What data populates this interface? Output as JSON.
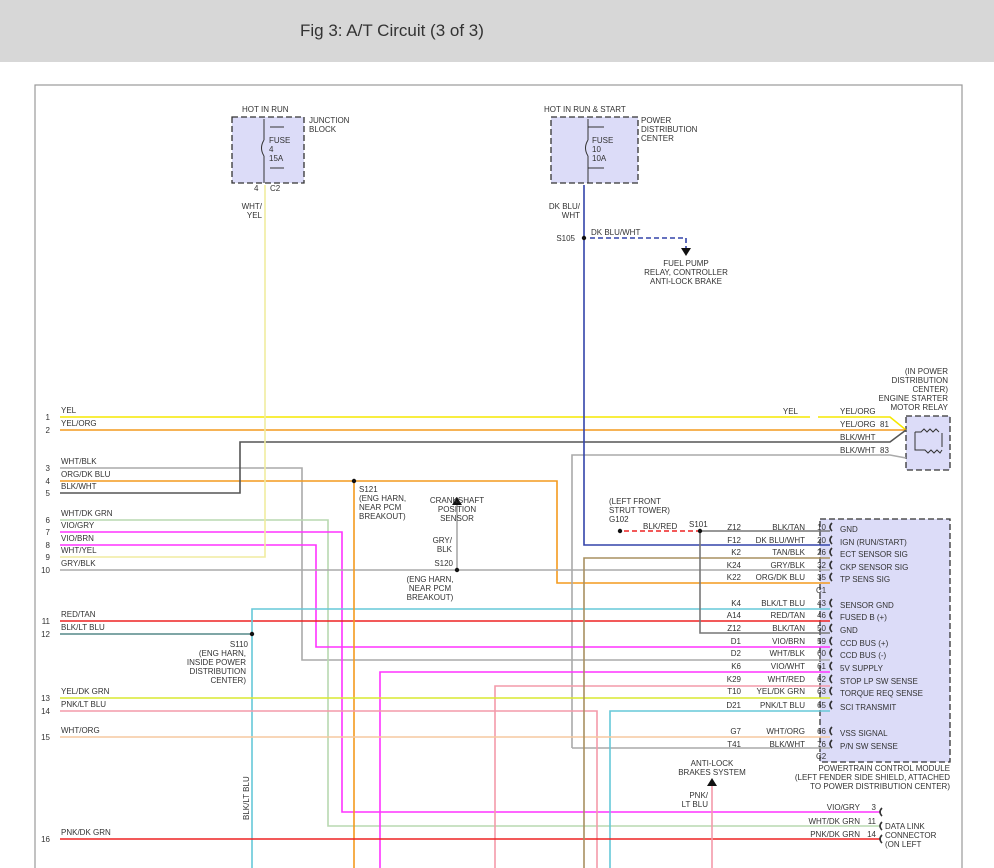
{
  "header": {
    "title": "Fig 3: A/T Circuit (3 of 3)"
  },
  "junction_block": {
    "hot": "HOT IN RUN",
    "name": [
      "JUNCTION",
      "BLOCK"
    ],
    "fuse": [
      "FUSE",
      "4",
      "15A"
    ],
    "pin": "4",
    "connector": "C2",
    "wire": [
      "WHT/",
      "YEL"
    ]
  },
  "pdc": {
    "hot": "HOT IN RUN & START",
    "name": [
      "POWER",
      "DISTRIBUTION",
      "CENTER"
    ],
    "fuse": [
      "FUSE",
      "10",
      "10A"
    ],
    "wire": [
      "DK BLU/",
      "WHT"
    ],
    "splice": "S105",
    "branch_wire": "DK BLU/WHT",
    "branch_dest": [
      "FUEL PUMP",
      "RELAY, CONTROLLER",
      "ANTI-LOCK BRAKE"
    ]
  },
  "relay": {
    "label": [
      "(IN POWER",
      "DISTRIBUTION",
      "CENTER)",
      "ENGINE STARTER",
      "MOTOR RELAY"
    ],
    "wires": [
      {
        "name": "YEL"
      },
      {
        "name": "YEL/ORG"
      },
      {
        "name": "YEL/ORG",
        "pin": "81"
      },
      {
        "name": "BLK/WHT"
      },
      {
        "name": "BLK/WHT",
        "pin": "83"
      }
    ]
  },
  "left_wires": [
    {
      "num": "1",
      "label": "YEL"
    },
    {
      "num": "2",
      "label": "YEL/ORG"
    },
    {
      "num": "3",
      "label": "WHT/BLK"
    },
    {
      "num": "4",
      "label": "ORG/DK BLU"
    },
    {
      "num": "5",
      "label": "BLK/WHT"
    },
    {
      "num": "6",
      "label": "WHT/DK GRN"
    },
    {
      "num": "7",
      "label": "VIO/GRY"
    },
    {
      "num": "8",
      "label": "VIO/BRN"
    },
    {
      "num": "9",
      "label": "WHT/YEL"
    },
    {
      "num": "10",
      "label": "GRY/BLK"
    },
    {
      "num": "11",
      "label": "RED/TAN"
    },
    {
      "num": "12",
      "label": "BLK/LT BLU"
    },
    {
      "num": "13",
      "label": "YEL/DK GRN"
    },
    {
      "num": "14",
      "label": "PNK/LT BLU"
    },
    {
      "num": "15",
      "label": "WHT/ORG"
    },
    {
      "num": "16",
      "label": "PNK/DK GRN"
    }
  ],
  "splices": {
    "s121": [
      "S121",
      "(ENG HARN,",
      "NEAR PCM",
      "BREAKOUT)"
    ],
    "s120": [
      "S120",
      "(ENG HARN,",
      "NEAR PCM",
      "BREAKOUT)"
    ],
    "s110": [
      "S110",
      "(ENG HARN,",
      "INSIDE POWER",
      "DISTRIBUTION",
      "CENTER)"
    ],
    "s110_wire": "BLK/LT BLU",
    "s101": "S101",
    "g102": [
      "(LEFT FRONT",
      "STRUT TOWER)",
      "G102"
    ],
    "g102_wire": "BLK/RED"
  },
  "crank_sensor": {
    "label": [
      "CRANKSHAFT",
      "POSITION",
      "SENSOR"
    ],
    "wire": [
      "GRY/",
      "BLK"
    ]
  },
  "abs": {
    "label": [
      "ANTI-LOCK",
      "BRAKES SYSTEM"
    ],
    "wire": [
      "PNK/",
      "LT BLU"
    ]
  },
  "pcm": {
    "pins": [
      {
        "code": "Z12",
        "wire": "BLK/TAN",
        "pin": "10",
        "func": "GND"
      },
      {
        "code": "F12",
        "wire": "DK BLU/WHT",
        "pin": "20",
        "func": "IGN (RUN/START)"
      },
      {
        "code": "K2",
        "wire": "TAN/BLK",
        "pin": "26",
        "func": "ECT SENSOR SIG"
      },
      {
        "code": "K24",
        "wire": "GRY/BLK",
        "pin": "32",
        "func": "CKP SENSOR SIG"
      },
      {
        "code": "K22",
        "wire": "ORG/DK BLU",
        "pin": "35",
        "func": "TP SENS SIG"
      },
      {
        "code": "K4",
        "wire": "BLK/LT BLU",
        "pin": "43",
        "func": "SENSOR GND"
      },
      {
        "code": "A14",
        "wire": "RED/TAN",
        "pin": "46",
        "func": "FUSED B (+)"
      },
      {
        "code": "Z12",
        "wire": "BLK/TAN",
        "pin": "50",
        "func": "GND"
      },
      {
        "code": "D1",
        "wire": "VIO/BRN",
        "pin": "59",
        "func": "CCD BUS (+)"
      },
      {
        "code": "D2",
        "wire": "WHT/BLK",
        "pin": "60",
        "func": "CCD BUS (-)"
      },
      {
        "code": "K6",
        "wire": "VIO/WHT",
        "pin": "61",
        "func": "5V SUPPLY"
      },
      {
        "code": "K29",
        "wire": "WHT/RED",
        "pin": "62",
        "func": "STOP LP SW SENSE"
      },
      {
        "code": "T10",
        "wire": "YEL/DK GRN",
        "pin": "63",
        "func": "TORQUE REQ SENSE"
      },
      {
        "code": "D21",
        "wire": "PNK/LT BLU",
        "pin": "65",
        "func": "SCI TRANSMIT"
      },
      {
        "code": "G7",
        "wire": "WHT/ORG",
        "pin": "66",
        "func": "VSS SIGNAL"
      },
      {
        "code": "T41",
        "wire": "BLK/WHT",
        "pin": "76",
        "func": "P/N SW SENSE"
      }
    ],
    "c1": "C1",
    "c2": "C2",
    "label": [
      "POWERTRAIN CONTROL MODULE",
      "(LEFT FENDER SIDE SHIELD, ATTACHED",
      "TO POWER DISTRIBUTION CENTER)"
    ]
  },
  "dlc": {
    "pins": [
      {
        "wire": "VIO/GRY",
        "pin": "3"
      },
      {
        "wire": "WHT/DK GRN",
        "pin": "11"
      },
      {
        "wire": "PNK/DK GRN",
        "pin": "14"
      }
    ],
    "label": [
      "DATA LINK",
      "CONNECTOR",
      "(ON LEFT"
    ]
  },
  "colors": {
    "yel": "#f5e800",
    "org": "#f39a1e",
    "gry": "#aaaaaa",
    "dkgry": "#555555",
    "grn": "#b8d8b0",
    "vio": "#ff33ff",
    "blu": "#3344aa",
    "red": "#ee2222",
    "pnk": "#f39aaa",
    "ltblu": "#66c8d8",
    "tan": "#a89060",
    "box": "#dcdcf8"
  }
}
